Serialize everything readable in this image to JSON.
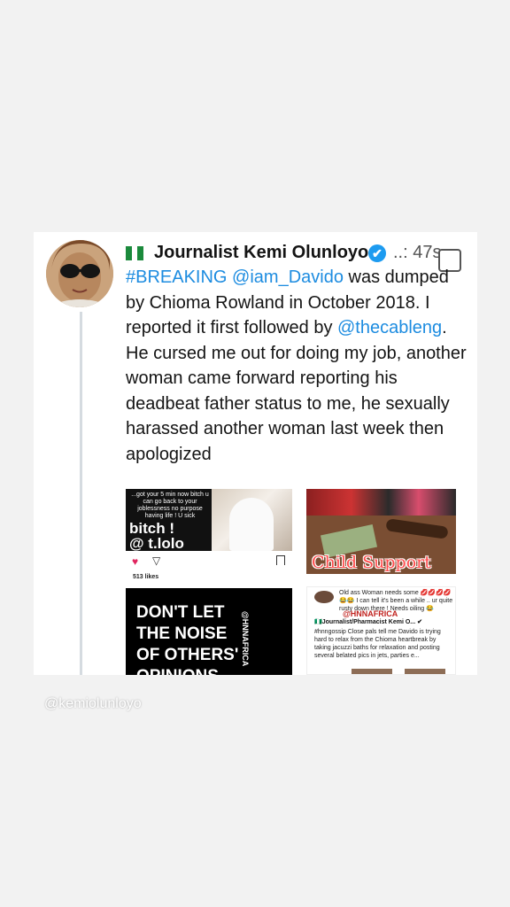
{
  "tweet": {
    "author_name": "Journalist Kemi Olunloyo",
    "meta": "..: 47s",
    "text_segments": [
      {
        "text": "#BREAKING",
        "link": true
      },
      {
        "text": " ",
        "link": false
      },
      {
        "text": "@iam_Davido",
        "link": true
      },
      {
        "text": " was dumped by Chioma Rowland in October 2018. I reported it first followed by ",
        "link": false
      },
      {
        "text": "@thecableng",
        "link": true
      },
      {
        "text": ". He cursed me out for doing my job, another woman came forward reporting his deadbeat father status to me, he sexually harassed another woman last week then apologized",
        "link": false
      }
    ],
    "verified_mark": "✔"
  },
  "media": {
    "image1": {
      "small_text": "...got your 5 min now bitch u can go back to your joblessness no purpose having life ! U sick",
      "big_text_line1": "bitch !",
      "big_text_line2": "@ t.lolo",
      "likes": "513 likes"
    },
    "image2": {
      "label": "Child Support"
    },
    "image3": {
      "line1": "DON'T LET",
      "line2": "THE NOISE",
      "line3": "OF OTHERS'",
      "line4": "OPINIONS",
      "watermark": "@HNNAFRICA"
    },
    "image4": {
      "comment": "Old ass Woman needs some 💋💋💋💋 😂😂 I can tell it's been a while .. ur quite rusty down there ! Needs oiling 😂",
      "brand": "@HNNAFRICA",
      "source": "🇳🇬Journalist/Pharmacist Kemi O... ✔",
      "body": "#hnngossip Close pals tell me Davido is trying hard to relax from the Chioma heartbreak by taking jacuzzi baths for relaxation and posting several belated pics in jets, parties e..."
    }
  },
  "footer": {
    "handle": "@kemiolunloyo"
  },
  "colors": {
    "link": "#1d8ce0",
    "background": "#f2f2f2",
    "card": "#ffffff"
  },
  "icons": [
    "nigeria-flag-icon",
    "verified-icon",
    "heart-icon",
    "send-icon",
    "bookmark-icon",
    "select-checkbox-icon"
  ]
}
